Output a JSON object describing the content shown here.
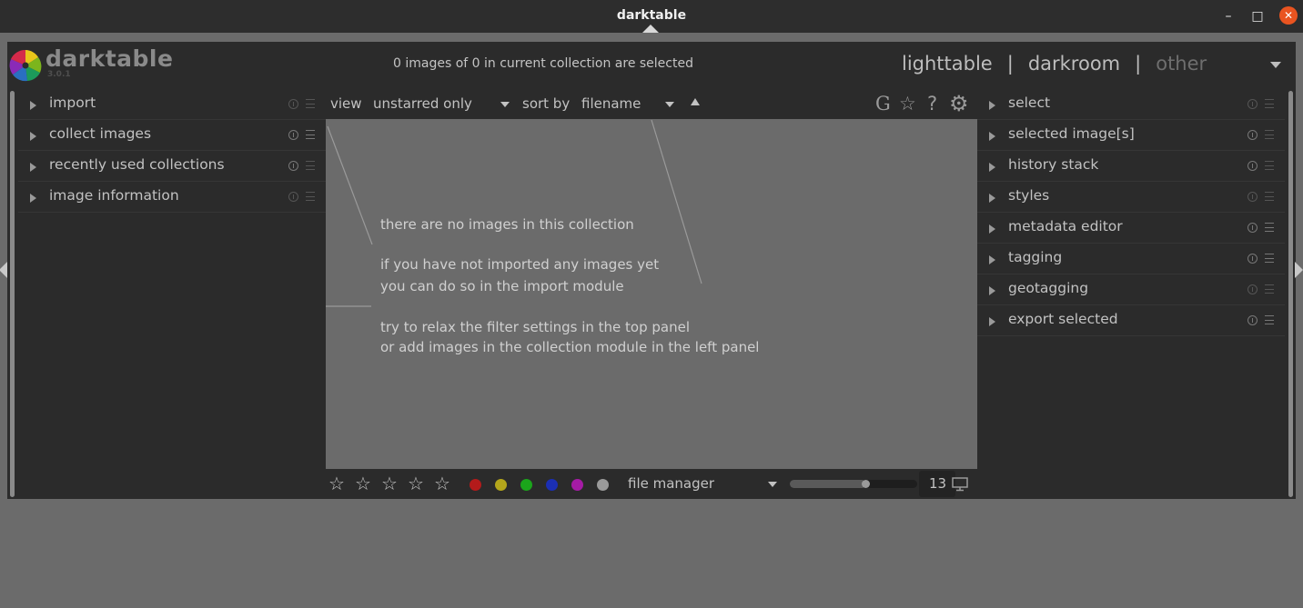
{
  "window": {
    "title": "darktable",
    "min_glyph": "–",
    "max_glyph": "□",
    "close_glyph": "✕"
  },
  "header": {
    "brand": "darktable",
    "version": "3.0.1",
    "selection_status": "0 images of 0 in current collection are selected",
    "views": {
      "lighttable": "lighttable",
      "separator": "|",
      "darkroom": "darkroom",
      "other": "other"
    }
  },
  "left_panel": {
    "modules": [
      {
        "label": "import"
      },
      {
        "label": "collect images"
      },
      {
        "label": "recently used collections"
      },
      {
        "label": "image information"
      }
    ]
  },
  "right_panel": {
    "modules": [
      {
        "label": "select"
      },
      {
        "label": "selected image[s]"
      },
      {
        "label": "history stack"
      },
      {
        "label": "styles"
      },
      {
        "label": "metadata editor"
      },
      {
        "label": "tagging"
      },
      {
        "label": "geotagging"
      },
      {
        "label": "export selected"
      }
    ]
  },
  "topbar": {
    "view_label": "view",
    "view_value": "unstarred only",
    "sort_label": "sort by",
    "sort_value": "filename",
    "icons": {
      "grouping": "G",
      "overlays": "☆",
      "help": "?",
      "preferences": "⚙"
    }
  },
  "center": {
    "messages": {
      "line1": "there are no images in this collection",
      "line2": "if you have not imported any images yet",
      "line3": "you can do so in the import module",
      "line4": "try to relax the filter settings in the top panel",
      "line5": "or add images in the collection module in the left panel"
    }
  },
  "bottombar": {
    "star_glyph": "☆",
    "color_labels": [
      "#b41b1b",
      "#b4a61b",
      "#1ba51b",
      "#1b2fb4",
      "#a51ba5",
      "#9a9a9a"
    ],
    "layout_value": "file manager",
    "zoom_fraction": 0.6,
    "zoom_value": "13",
    "display_icon": "monitor-icon"
  },
  "colors": {
    "panel_bg": "#2b2b2b",
    "center_bg": "#6b6b6b",
    "accent_close": "#e95420"
  }
}
